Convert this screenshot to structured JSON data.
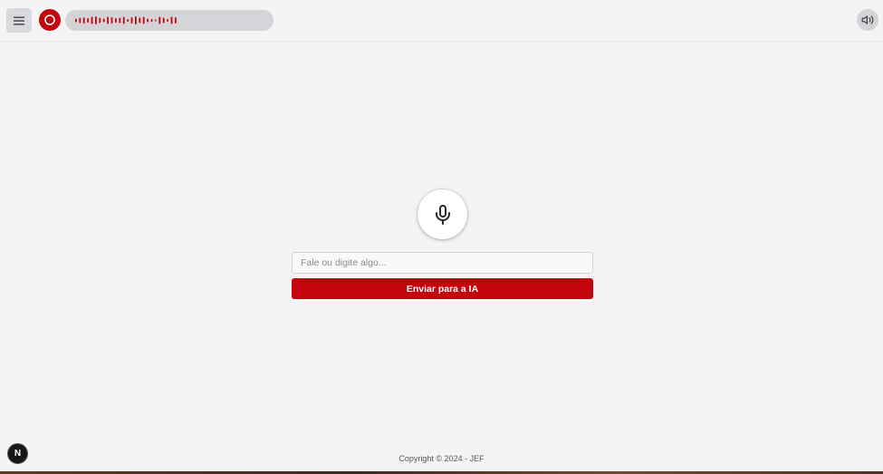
{
  "header": {
    "menu_icon": "hamburger-icon",
    "record_icon": "record-icon",
    "speaker_icon": "speaker-volume-icon",
    "waveform": {
      "color": "#c4040c",
      "bar_levels": [
        0.4,
        0.6,
        0.7,
        0.5,
        0.8,
        0.9,
        0.6,
        0.4,
        0.8,
        0.7,
        0.5,
        0.6,
        0.8,
        0.3,
        0.7,
        0.9,
        0.6,
        0.8,
        0.4,
        0.3,
        0.2,
        0.8,
        0.6,
        0.3,
        0.8,
        0.7
      ]
    }
  },
  "main": {
    "mic_icon": "microphone-icon",
    "input_placeholder": "Fale ou digite algo...",
    "input_value": "",
    "send_label": "Enviar para a IA"
  },
  "badge": {
    "label": "N"
  },
  "footer": {
    "copyright": "Copyright © 2024 - JEF"
  },
  "colors": {
    "accent": "#c4040c",
    "background": "#f4f4f5"
  }
}
